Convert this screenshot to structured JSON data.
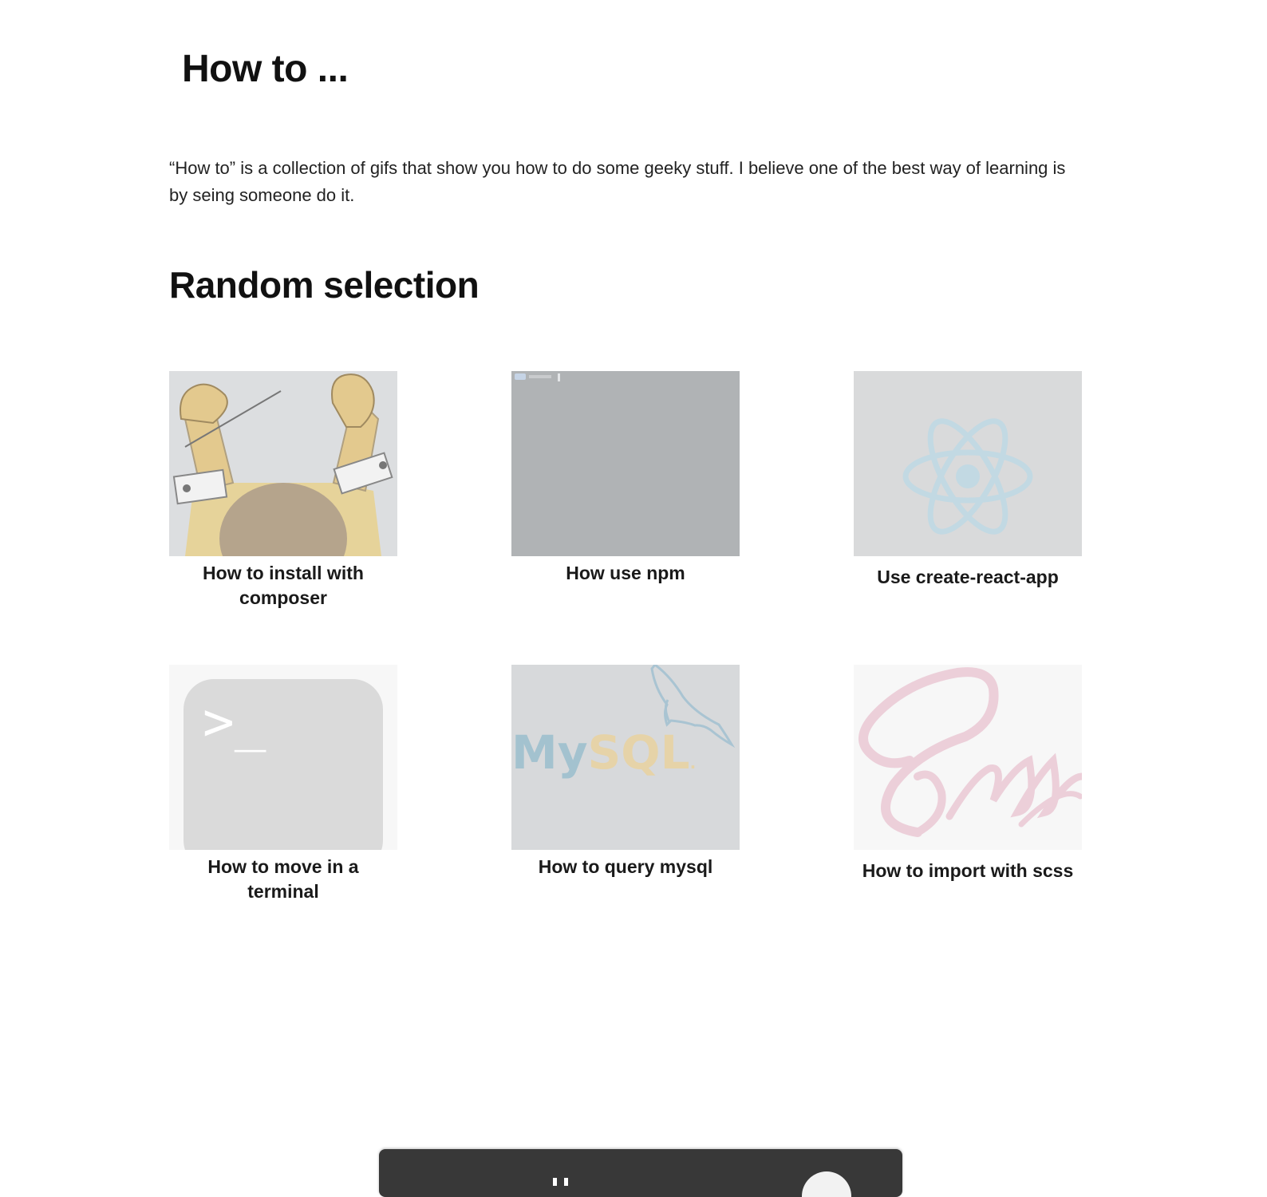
{
  "header": {
    "title": "How to ..."
  },
  "intro": {
    "text": "“How to” is a collection of gifs that show you how to do some geeky stuff. I believe one of the best way of learning is by seing someone do it."
  },
  "section": {
    "title": "Random selection"
  },
  "cards": [
    {
      "label": "How to install with composer",
      "image": "composer-conductor-image"
    },
    {
      "label": "How use npm",
      "image": "terminal-screen-image"
    },
    {
      "label": "Use create-react-app",
      "image": "react-logo-image"
    },
    {
      "label": "How to move in a terminal",
      "image": "terminal-app-icon-image"
    },
    {
      "label": "How to query mysql",
      "image": "mysql-logo-image"
    },
    {
      "label": "How to import with scss",
      "image": "sass-logo-image"
    }
  ],
  "images": {
    "mysql_logo_text": "MySQL",
    "sass_logo_text": "Sass",
    "terminal_prompt": ">_"
  },
  "colors": {
    "bottom_bar": "#383838",
    "thumb_grey": "#d8dadc",
    "terminal_grey": "#b0b3b5"
  }
}
